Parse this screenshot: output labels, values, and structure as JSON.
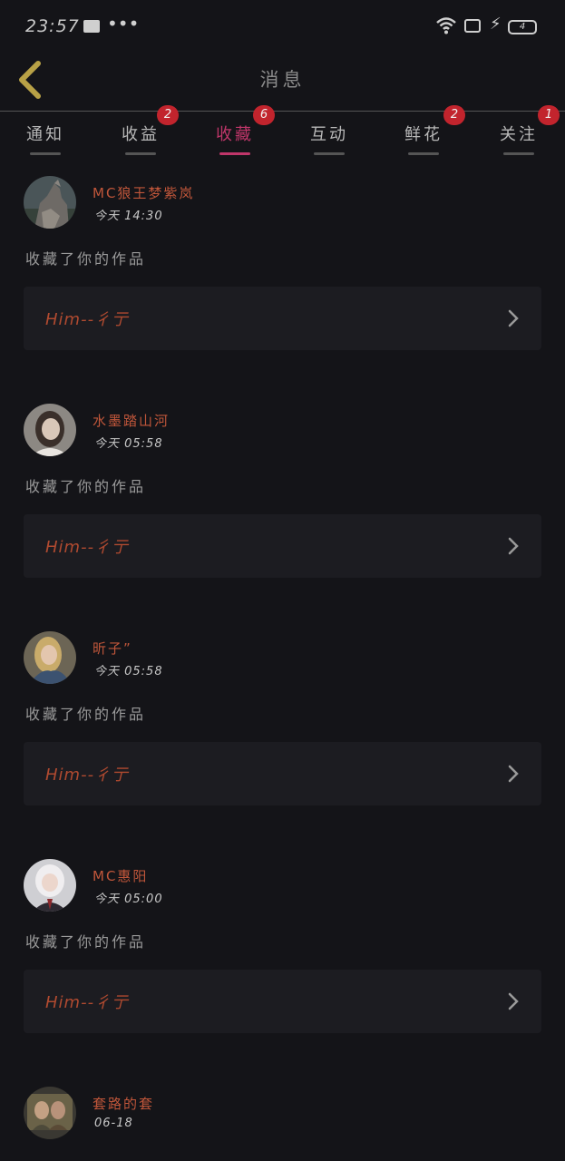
{
  "status_bar": {
    "time": "23:57",
    "battery": "4",
    "icons": [
      "mail-icon",
      "more-dots-icon",
      "wifi-icon",
      "screen-icon",
      "charging-bolt-icon",
      "battery-icon"
    ]
  },
  "header": {
    "title": "消息",
    "back_icon": "chevron-left-icon",
    "back_color": "#b8a146"
  },
  "tabs": [
    {
      "label": "通知",
      "badge": ""
    },
    {
      "label": "收益",
      "badge": "2"
    },
    {
      "label": "收藏",
      "badge": "6",
      "active": true
    },
    {
      "label": "互动",
      "badge": ""
    },
    {
      "label": "鲜花",
      "badge": "2"
    },
    {
      "label": "关注",
      "badge": "1"
    }
  ],
  "colors": {
    "accent": "#c0366a",
    "badge": "#c2242d",
    "username": "#c0563a",
    "background": "#141418",
    "card": "#1c1c21"
  },
  "items": [
    {
      "username": "MC狼王梦紫岚",
      "time": "今天 14:30",
      "message": "收藏了你的作品",
      "work_title": "Him--彳亍",
      "avatar": "wolf"
    },
    {
      "username": "水墨踏山河",
      "time": "今天 05:58",
      "message": "收藏了你的作品",
      "work_title": "Him--彳亍",
      "avatar": "girl-light"
    },
    {
      "username": "昕子”",
      "time": "今天 05:58",
      "message": "收藏了你的作品",
      "work_title": "Him--彳亍",
      "avatar": "girl-blonde"
    },
    {
      "username": "MC惠阳",
      "time": "今天 05:00",
      "message": "收藏了你的作品",
      "work_title": "Him--彳亍",
      "avatar": "anime"
    },
    {
      "username": "套路的套",
      "time": "06-18",
      "message": "",
      "work_title": "",
      "avatar": "couple"
    }
  ]
}
